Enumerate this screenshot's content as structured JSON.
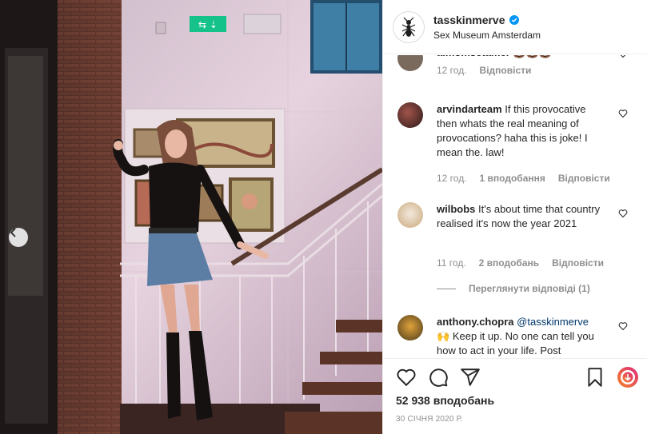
{
  "post": {
    "username": "tasskinmerve",
    "location": "Sex Museum Amsterdam",
    "verified": true
  },
  "photo": {
    "exit_sign_text": "⇆ ⇣"
  },
  "comments": [
    {
      "username": "aimomsetamer",
      "text": "",
      "emoji": "💩💩💩",
      "time": "12 год.",
      "likes_label": "",
      "reply_label": "Відповісти"
    },
    {
      "username": "arvindarteam",
      "text": "If this provocative then whats the real meaning of provocations? haha this is joke! I mean the. law!",
      "time": "12 год.",
      "likes_label": "1 вподобання",
      "reply_label": "Відповісти"
    },
    {
      "username": "wilbobs",
      "text": "It's about time that country realised it's now the year 2021",
      "time": "11 год.",
      "likes_label": "2 вподобань",
      "reply_label": "Відповісти",
      "view_replies": "Переглянути відповіді (1)"
    },
    {
      "username": "anthony.chopra",
      "mention": "@tasskinmerve",
      "emoji": "🙌",
      "text": "Keep it up. No one can tell you how to act in your life. Post"
    }
  ],
  "actions": {
    "likes_label": "52 938 вподобань",
    "date_label": "30 СІЧНЯ 2020 Р."
  },
  "colors": {
    "accent_blue": "#0095f6",
    "text_primary": "#262626",
    "text_secondary": "#8e8e8e",
    "reels_gradient_start": "#f58529",
    "reels_gradient_end": "#dd2a7b"
  },
  "icons": [
    "ant-logo-icon",
    "verified-badge-icon",
    "heart-icon",
    "comment-icon",
    "share-icon",
    "bookmark-icon",
    "reels-icon",
    "chevron-left-icon"
  ]
}
